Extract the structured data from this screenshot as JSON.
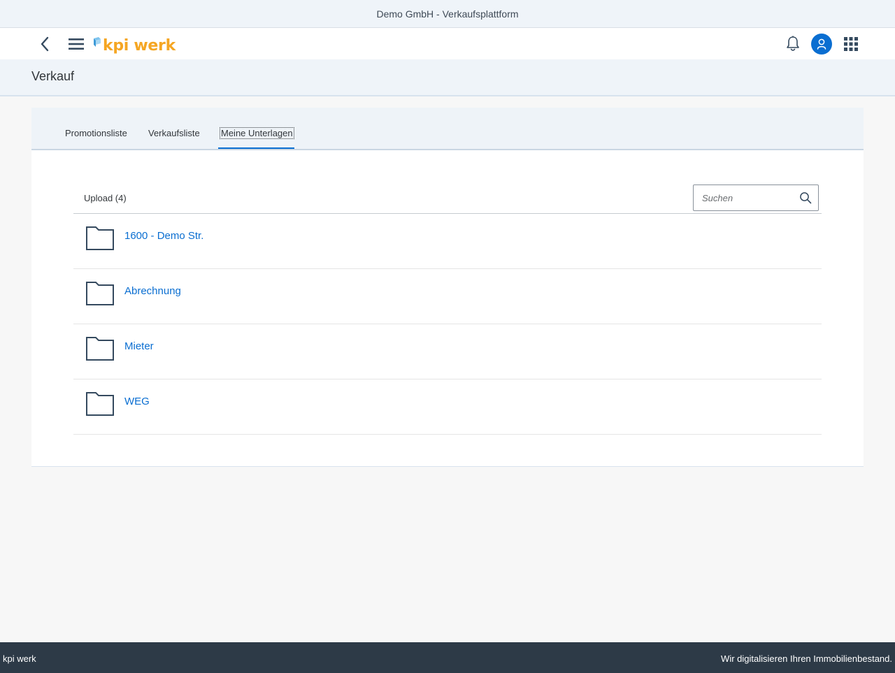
{
  "window": {
    "title": "Demo GmbH - Verkaufsplattform"
  },
  "shellbar": {
    "logo_text": "kpi werk",
    "icons": [
      "back-icon",
      "hamburger-menu-icon",
      "bell-icon",
      "user-icon",
      "app-grid-icon"
    ]
  },
  "page": {
    "title": "Verkauf"
  },
  "tabs": [
    {
      "label": "Promotionsliste",
      "selected": false
    },
    {
      "label": "Verkaufsliste",
      "selected": false
    },
    {
      "label": "Meine Unterlagen",
      "selected": true
    }
  ],
  "list": {
    "title": "Upload (4)",
    "search": {
      "placeholder": "Suchen",
      "value": ""
    },
    "items": [
      {
        "label": "1600 - Demo Str.",
        "icon": "folder-icon"
      },
      {
        "label": "Abrechnung",
        "icon": "folder-icon"
      },
      {
        "label": "Mieter",
        "icon": "folder-icon"
      },
      {
        "label": "WEG",
        "icon": "folder-icon"
      }
    ]
  },
  "footer": {
    "left": "kpi werk",
    "right": "Wir digitalisieren Ihren Immobilienbestand."
  },
  "colors": {
    "accent": "#0a6ed1",
    "logo": "#f5a623",
    "footer_bg": "#2d3a47",
    "header_bg": "#eff4f9"
  }
}
